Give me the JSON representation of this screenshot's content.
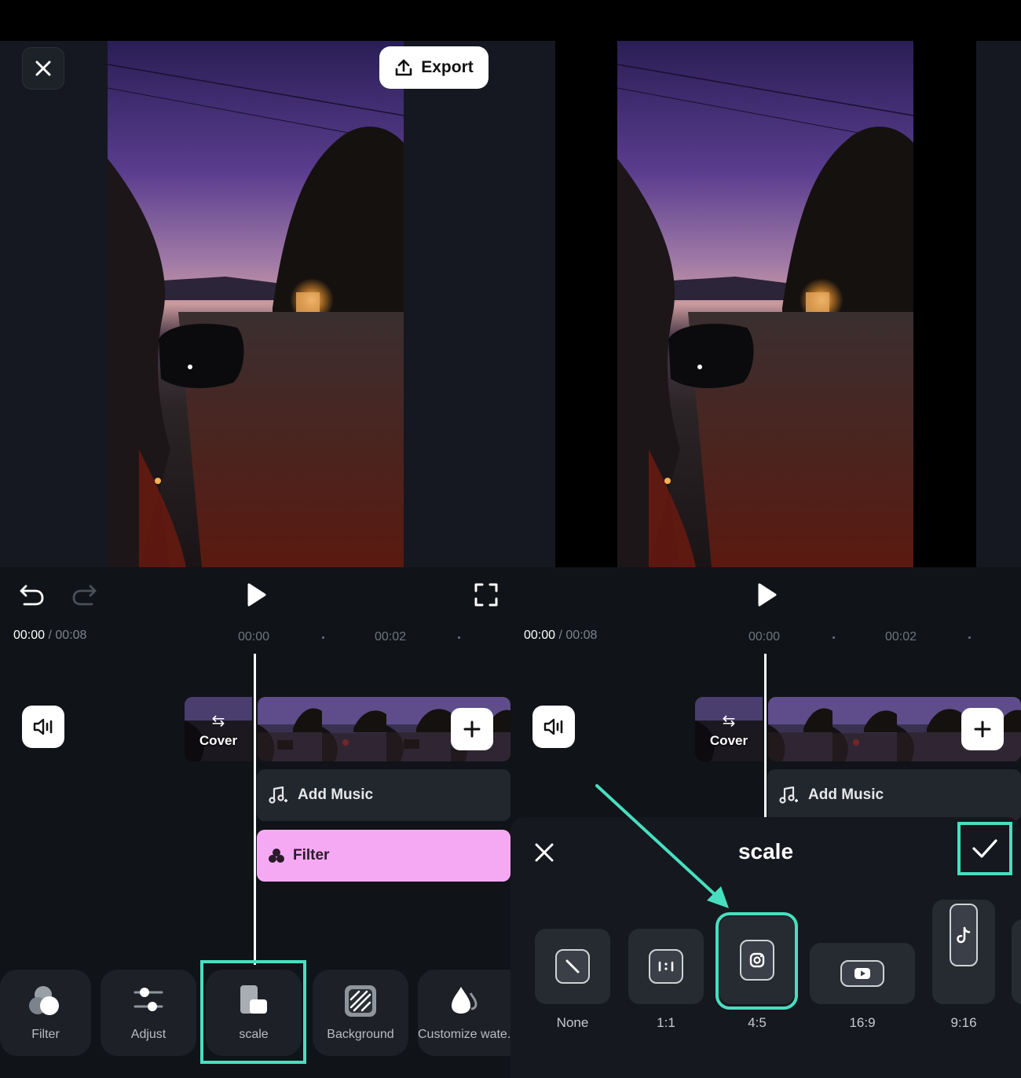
{
  "left": {
    "header": {
      "export_label": "Export"
    },
    "timeline": {
      "current_time": "00:00",
      "separator": " / ",
      "total_time": "00:08",
      "ruler": [
        "00:00",
        "00:02"
      ],
      "cover_label": "Cover",
      "music_label": "Add Music",
      "filter_label": "Filter"
    },
    "toolbar": [
      {
        "label": "Filter",
        "icon": "filter-icon"
      },
      {
        "label": "Adjust",
        "icon": "adjust-icon"
      },
      {
        "label": "scale",
        "icon": "scale-icon",
        "highlighted": true
      },
      {
        "label": "Background",
        "icon": "background-icon"
      },
      {
        "label": "Customize wate.",
        "icon": "watermark-icon"
      }
    ]
  },
  "right": {
    "timeline": {
      "current_time": "00:00",
      "separator": " / ",
      "total_time": "00:08",
      "ruler": [
        "00:00",
        "00:02"
      ],
      "cover_label": "Cover",
      "music_label": "Add Music"
    },
    "scale_sheet": {
      "title": "scale",
      "options": [
        {
          "label": "None",
          "icon": "none-ratio-icon"
        },
        {
          "label": "1:1",
          "icon": "square-ratio-icon"
        },
        {
          "label": "4:5",
          "icon": "instagram-icon",
          "selected": true
        },
        {
          "label": "16:9",
          "icon": "youtube-icon"
        },
        {
          "label": "9:16",
          "icon": "tiktok-icon"
        }
      ]
    }
  },
  "colors": {
    "highlight": "#47dfc0",
    "filter_track": "#f6a9f3",
    "background": "#101317"
  }
}
